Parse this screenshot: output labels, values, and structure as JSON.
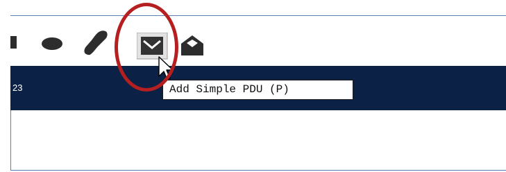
{
  "toolbar": {
    "tools": [
      {
        "icon": "square-tool-icon"
      },
      {
        "icon": "ellipse-tool-icon"
      },
      {
        "icon": "freeform-tool-icon"
      },
      {
        "icon": "closed-envelope-icon",
        "state": "hovered"
      },
      {
        "icon": "open-envelope-icon"
      }
    ]
  },
  "status": {
    "text": "23"
  },
  "tooltip": {
    "text": "Add Simple PDU (P)"
  },
  "colors": {
    "status_bar": "#0b2146",
    "highlight": "#b51f1f",
    "frame_border": "#5a7fae"
  }
}
